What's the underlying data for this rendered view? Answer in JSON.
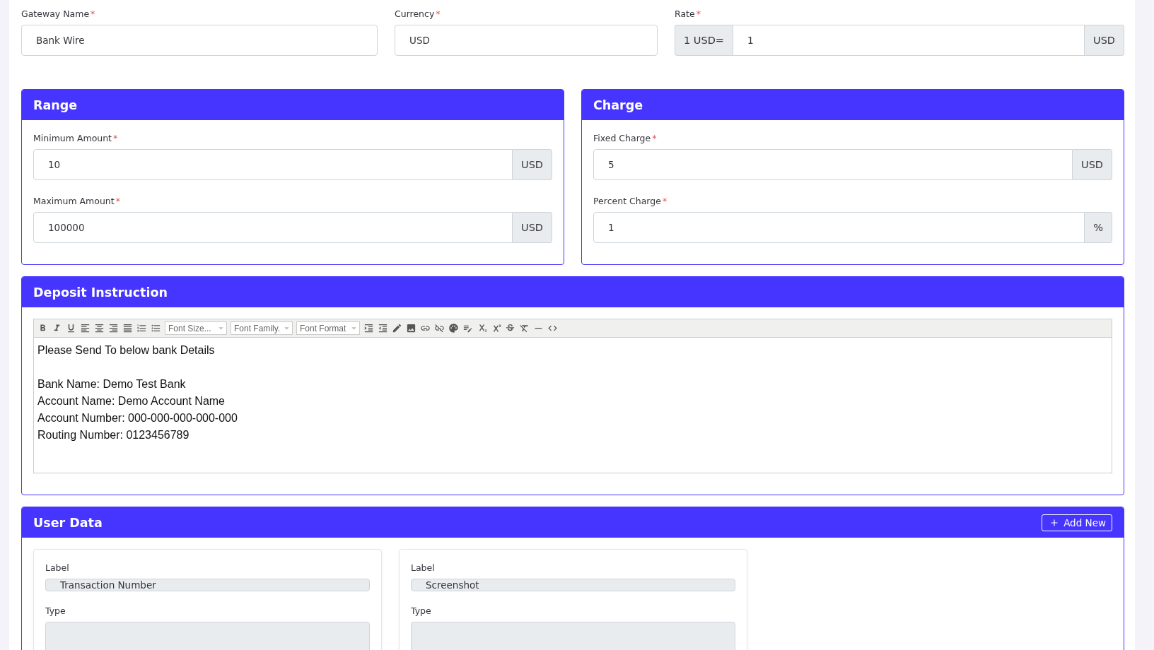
{
  "top_fields": [
    {
      "label": "Gateway Name",
      "mark": "*",
      "value": "Bank Wire"
    },
    {
      "label": "Currency",
      "mark": "*",
      "value": "USD"
    },
    {
      "label": "Rate",
      "mark": "*",
      "prefix": "1 USD=",
      "value": "1",
      "suffix": "USD"
    }
  ],
  "range": {
    "title": "Range",
    "fields": [
      {
        "label": "Minimum Amount",
        "mark": "*",
        "value": "10",
        "suffix": "USD"
      },
      {
        "label": "Maximum Amount",
        "mark": "*",
        "value": "100000",
        "suffix": "USD"
      }
    ]
  },
  "charge": {
    "title": "Charge",
    "fields": [
      {
        "label": "Fixed Charge",
        "mark": "*",
        "value": "5",
        "suffix": "USD"
      },
      {
        "label": "Percent Charge",
        "mark": "*",
        "value": "1",
        "suffix": "%"
      }
    ]
  },
  "deposit_instruction": {
    "title": "Deposit Instruction",
    "editor_selects": [
      "Font Size...",
      "Font Family.",
      "Font Format"
    ],
    "paragraphs": [
      [
        "Please Send To below bank Details"
      ],
      [
        "Bank Name: Demo Test Bank",
        "Account Name: Demo Account Name",
        "Account Number: 000-000-000-000-000",
        "Routing Number: 0123456789"
      ]
    ]
  },
  "user_data": {
    "title": "User Data",
    "add_button": "Add New",
    "items": [
      {
        "label_caption": "Label",
        "label_value": "Transaction Number",
        "type_caption": "Type"
      },
      {
        "label_caption": "Label",
        "label_value": "Screenshot",
        "type_caption": "Type"
      }
    ]
  }
}
